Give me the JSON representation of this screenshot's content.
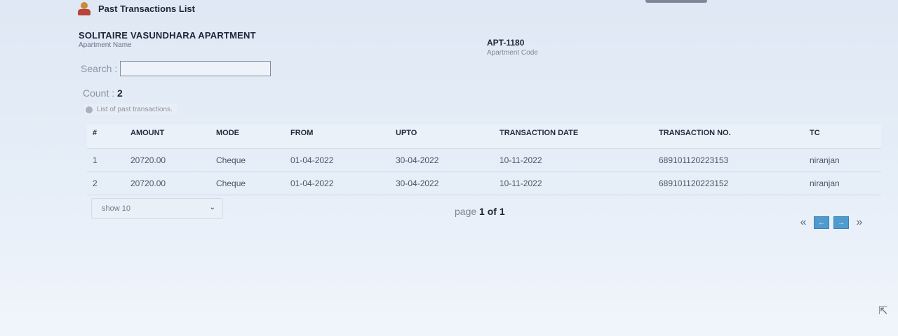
{
  "header": {
    "title": "Past Transactions List"
  },
  "apartment": {
    "name": "SOLITAIRE VASUNDHARA APARTMENT",
    "name_label": "Apartment Name",
    "code": "APT-1180",
    "code_label": "Apartment Code"
  },
  "search": {
    "label": "Search :",
    "value": ""
  },
  "count": {
    "label": "Count :",
    "value": "2"
  },
  "caption": "List of past transactions.",
  "table": {
    "columns": [
      "#",
      "AMOUNT",
      "MODE",
      "FROM",
      "UPTO",
      "TRANSACTION DATE",
      "TRANSACTION NO.",
      "TC"
    ],
    "rows": [
      [
        "1",
        "20720.00",
        "Cheque",
        "01-04-2022",
        "30-04-2022",
        "10-11-2022",
        "689101120223153",
        "niranjan"
      ],
      [
        "2",
        "20720.00",
        "Cheque",
        "01-04-2022",
        "30-04-2022",
        "10-11-2022",
        "689101120223152",
        "niranjan"
      ]
    ]
  },
  "footer": {
    "show_select": "show 10",
    "page_label": "page",
    "page_current": "1",
    "page_of": "of 1"
  },
  "pager": {
    "first": "«",
    "prev": "←",
    "next": "→",
    "last": "»"
  },
  "icons": {
    "logo": "temple-logo-icon",
    "select": "chevron-down-icon",
    "cursor": "mouse-cursor-icon"
  }
}
